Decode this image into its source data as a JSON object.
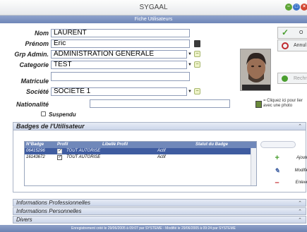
{
  "window": {
    "title": "SYGAAL",
    "subtitle": "Fiche Utilisateurs"
  },
  "form": {
    "nom": {
      "label": "Nom",
      "value": "LAURENT"
    },
    "prenom": {
      "label": "Prénom",
      "value": "Eric"
    },
    "grp_admin": {
      "label": "Grp Admin.",
      "value": "ADMINISTRATION GENERALE"
    },
    "categorie": {
      "label": "Categorie",
      "value": "TEST"
    },
    "matricule": {
      "label": "Matricule",
      "value": ""
    },
    "societe": {
      "label": "Société",
      "value": "SOCIETE 1"
    },
    "nationalite": {
      "label": "Nationalité",
      "value": ""
    },
    "suspendu": {
      "label": "Suspendu",
      "checked": false
    }
  },
  "actions": {
    "ok": "O",
    "annuler": "Annul",
    "rechercher": "Rechre"
  },
  "photo_hint": "= Cliquez ici pour lier avec une photo",
  "badges": {
    "title": "Badges de l'Utilisateur",
    "columns": [
      "N°Badge",
      "Profil",
      "Libellé Profil",
      "Statut du Badge"
    ],
    "rows": [
      {
        "badge": "06415296",
        "profil": true,
        "libelle": "TOUT AUTORISE",
        "statut": "Actif",
        "selected": true
      },
      {
        "badge": "16143672",
        "profil": true,
        "libelle": "TOUT AUTORISE",
        "statut": "Actif",
        "selected": false
      }
    ],
    "buttons": {
      "add": "Ajouter",
      "modify": "Modifier",
      "remove": "Enlever"
    }
  },
  "sections": [
    "Informations Professionnelles",
    "Informations Personnelles",
    "Divers"
  ],
  "status_bar": "Enregistrement créé le 29/06/2005 à 09:07 par SYSTEME - Modifié le 29/06/2005 à 09:24 par SYSTEME",
  "colors": {
    "header_blue": "#7088ba",
    "selected_row": "#3f5ca0",
    "ok_green": "#4a9e2f",
    "cancel_red": "#c0282d"
  }
}
